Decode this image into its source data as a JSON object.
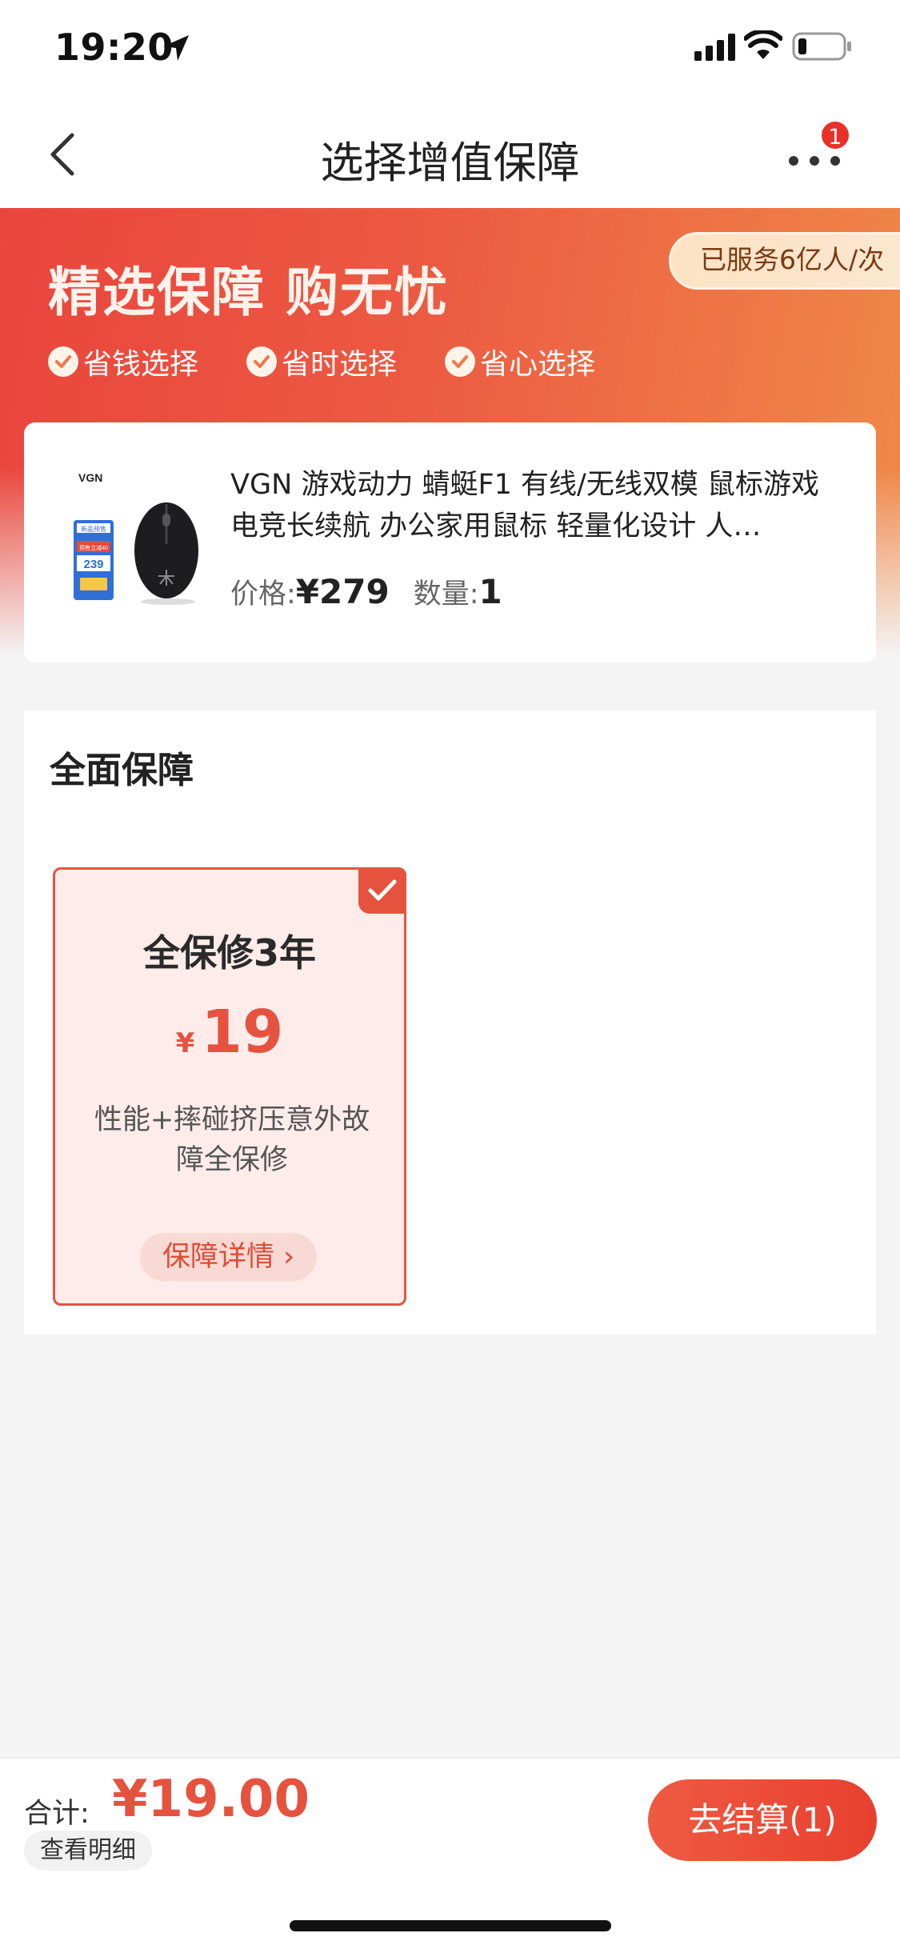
{
  "status_bar": {
    "time": "19:20"
  },
  "nav": {
    "title": "选择增值保障",
    "badge_count": "1"
  },
  "hero": {
    "headline": "精选保障 购无忧",
    "served_badge": "已服务6亿人/次",
    "features": [
      "省钱选择",
      "省时选择",
      "省心选择"
    ]
  },
  "product": {
    "title": "VGN 游戏动力 蜻蜓F1 有线/无线双模 鼠标游戏电竞长续航 办公家用鼠标 轻量化设计 人…",
    "price_label": "价格:",
    "price_value": "¥279",
    "qty_label": "数量:",
    "qty_value": "1",
    "image_text": {
      "brand": "VGN",
      "promo_top": "新品预售",
      "promo_tag": "预售立减40",
      "promo_price": "239"
    }
  },
  "section": {
    "title": "全面保障"
  },
  "plan": {
    "name": "全保修3年",
    "currency": "¥",
    "amount": "19",
    "description": "性能+摔碰挤压意外故障全保修",
    "detail_label": "保障详情 ›",
    "selected": true
  },
  "footer": {
    "total_label": "合计:",
    "total_value": "¥19.00",
    "view_detail_label": "查看明细",
    "checkout_label": "去结算(1)"
  },
  "colors": {
    "accent": "#e5533f",
    "hero_start": "#e9453d",
    "hero_end": "#f08a48"
  }
}
